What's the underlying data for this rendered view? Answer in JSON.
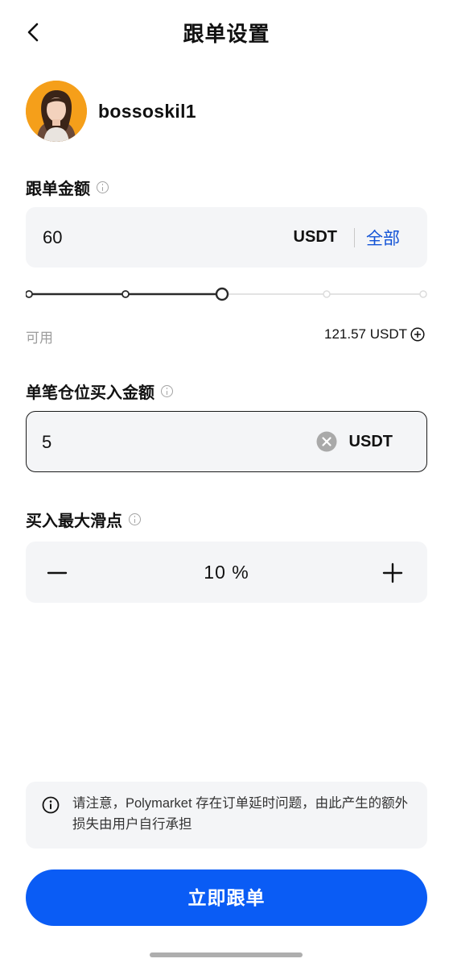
{
  "header": {
    "title": "跟单设置",
    "back_icon": "chevron-left-icon"
  },
  "trader": {
    "username": "bossoskil1",
    "avatar_bg": "#f59f1a"
  },
  "follow_amount": {
    "label": "跟单金额",
    "value": "60",
    "unit": "USDT",
    "all_label": "全部",
    "slider": {
      "steps": 5,
      "selected_index": 2,
      "active_color": "#2a2a2a",
      "inactive_color": "#e3e3e3"
    },
    "available_label": "可用",
    "available_value": "121.57 USDT"
  },
  "per_position": {
    "label": "单笔仓位买入金额",
    "value": "5",
    "unit": "USDT",
    "clear_icon": "clear-icon"
  },
  "slippage": {
    "label": "买入最大滑点",
    "value": "10 %",
    "minus_icon": "minus-icon",
    "plus_icon": "plus-icon"
  },
  "notice": {
    "text": "请注意，Polymarket 存在订单延时问题，由此产生的额外损失由用户自行承担"
  },
  "submit": {
    "label": "立即跟单",
    "color": "#0a5cf5"
  }
}
